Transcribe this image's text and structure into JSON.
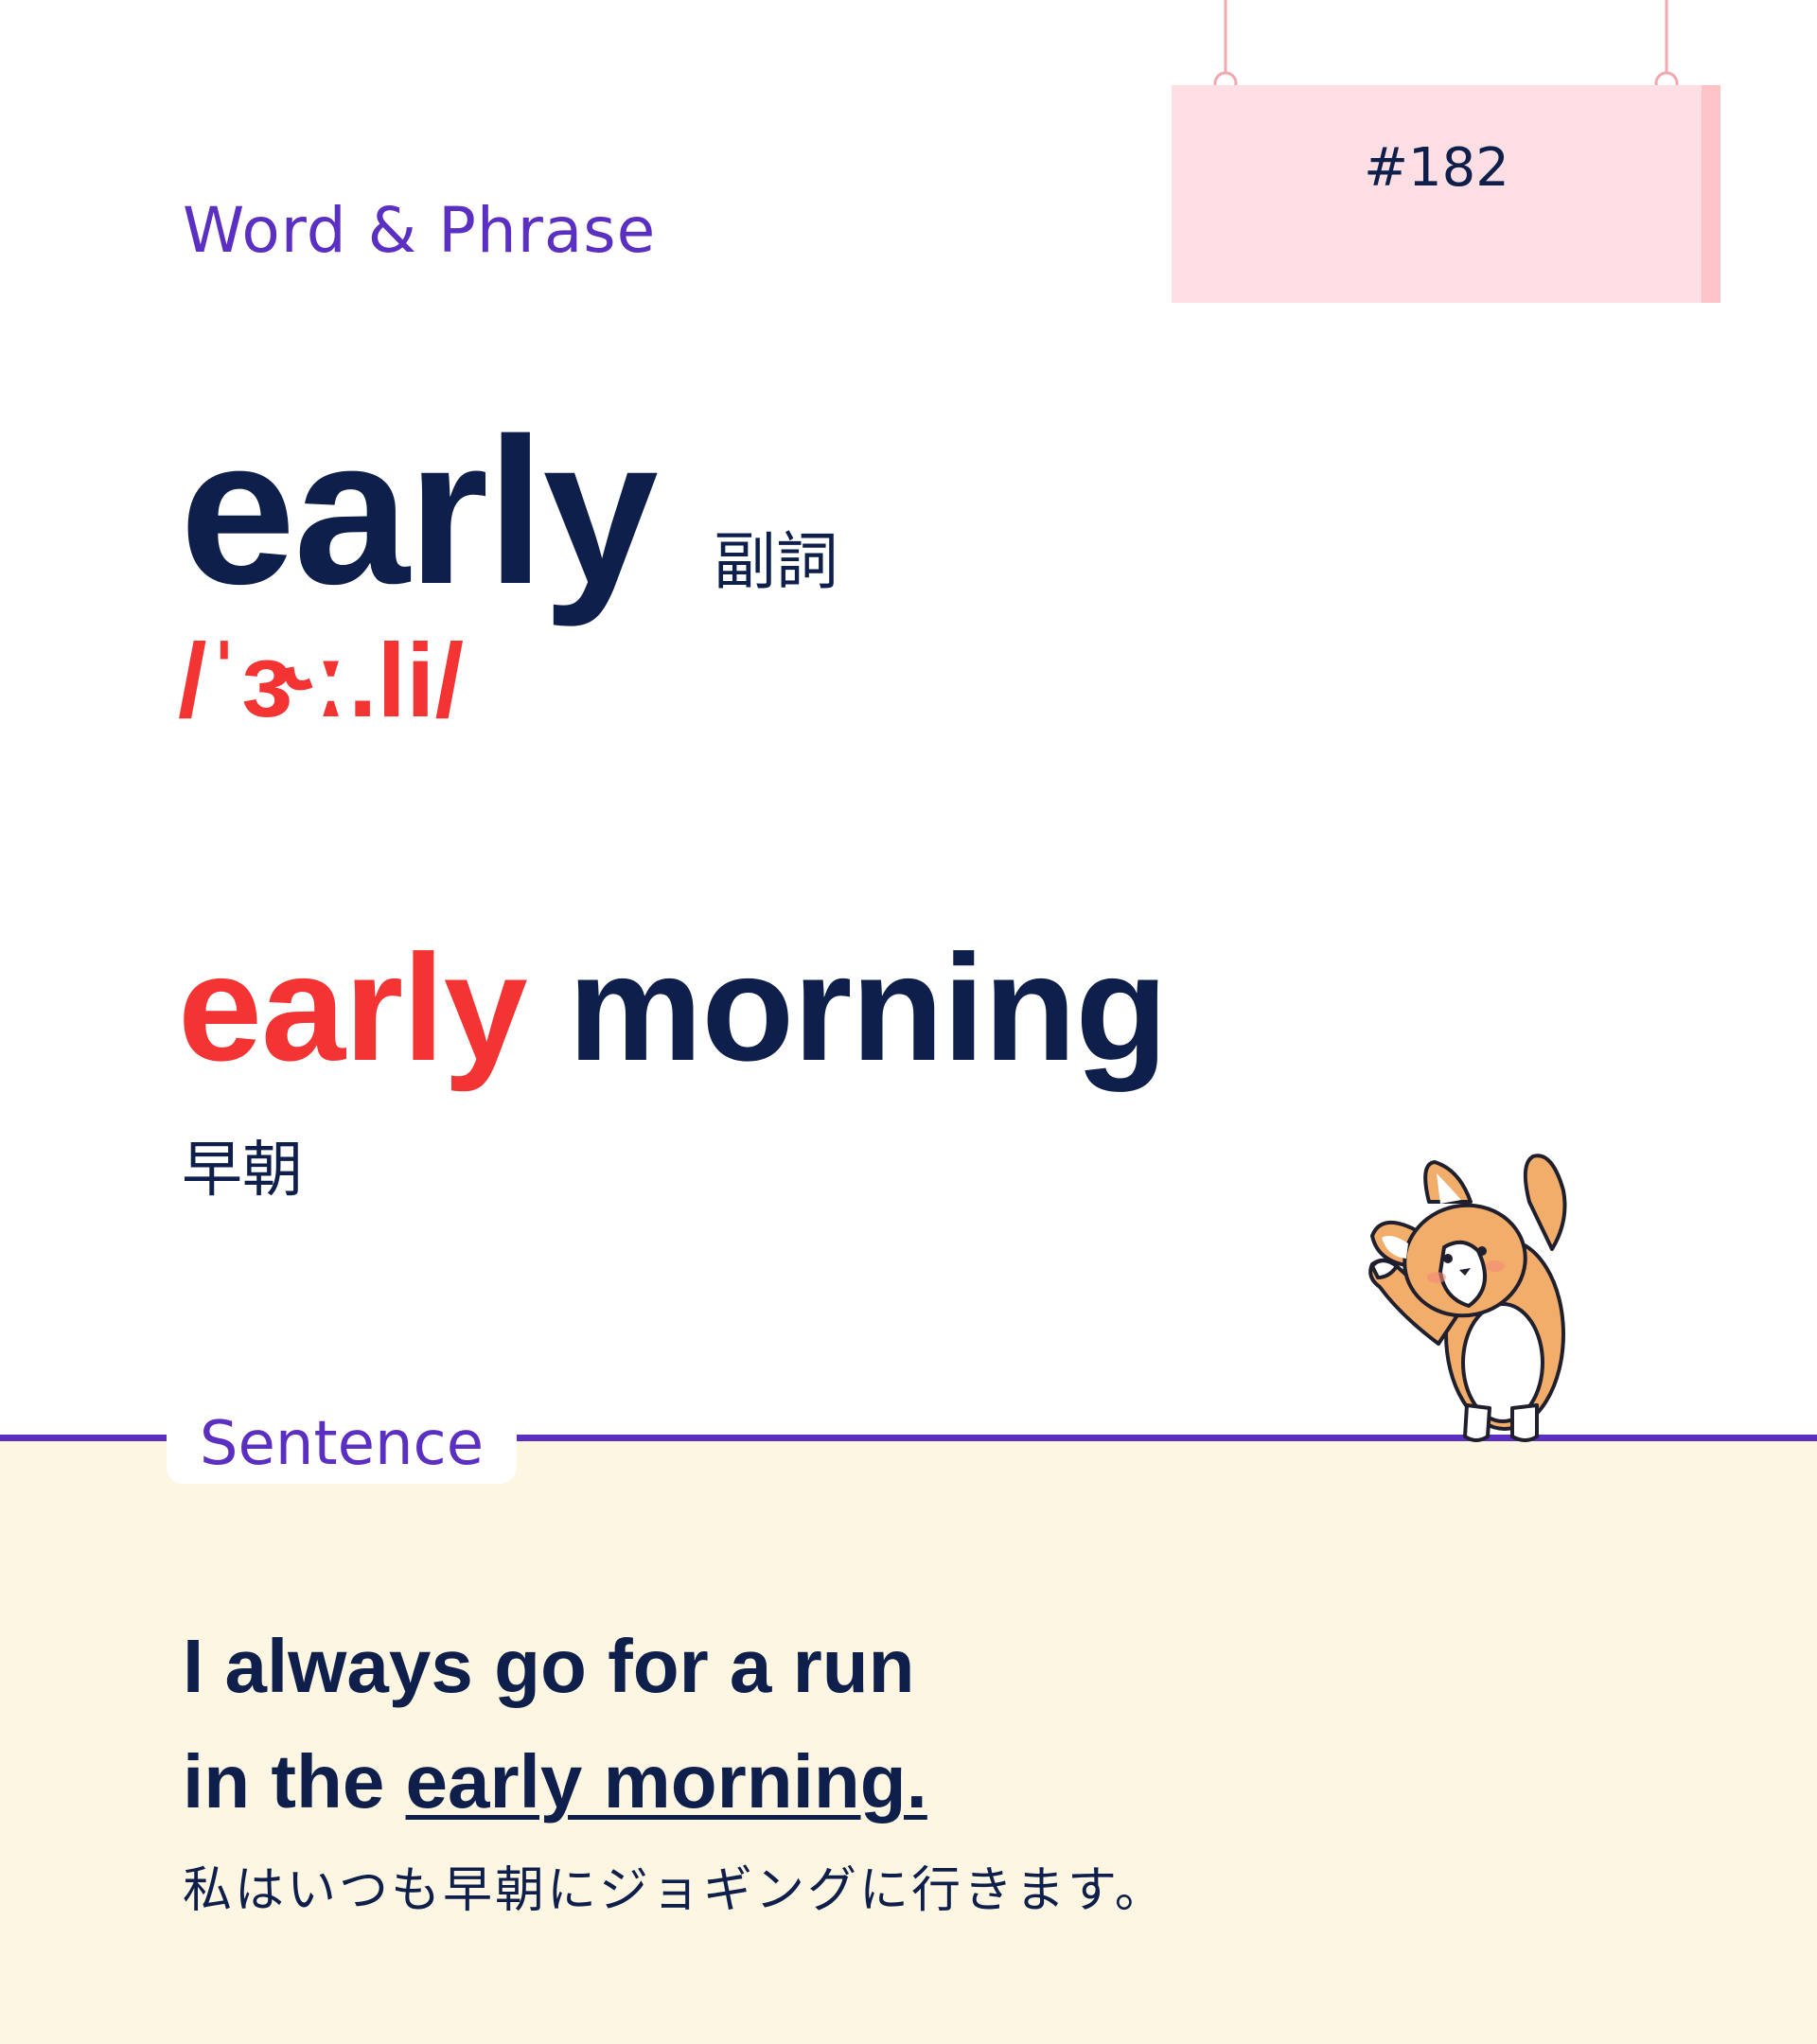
{
  "header": {
    "category": "Word & Phrase",
    "number": "#182"
  },
  "entry": {
    "word": "early",
    "part_of_speech": "副詞",
    "pronunciation": "/ˈɝː.li/"
  },
  "phrase": {
    "highlight": "early",
    "rest": " morning",
    "translation": "早朝"
  },
  "sentence_section": {
    "tab_label": "Sentence",
    "line1": "I always go for a run",
    "line2_prefix": "in the ",
    "line2_underlined": "early morning.",
    "translation": "私はいつも早朝にジョギングに行きます。"
  },
  "colors": {
    "accent_purple": "#5b2fc2",
    "highlight_red": "#f43333",
    "text_navy": "#0d1f4a",
    "sign_pink": "#ffdfe3",
    "sentence_bg": "#fdf6e3"
  },
  "icons": {
    "mascot": "corgi-icon"
  }
}
